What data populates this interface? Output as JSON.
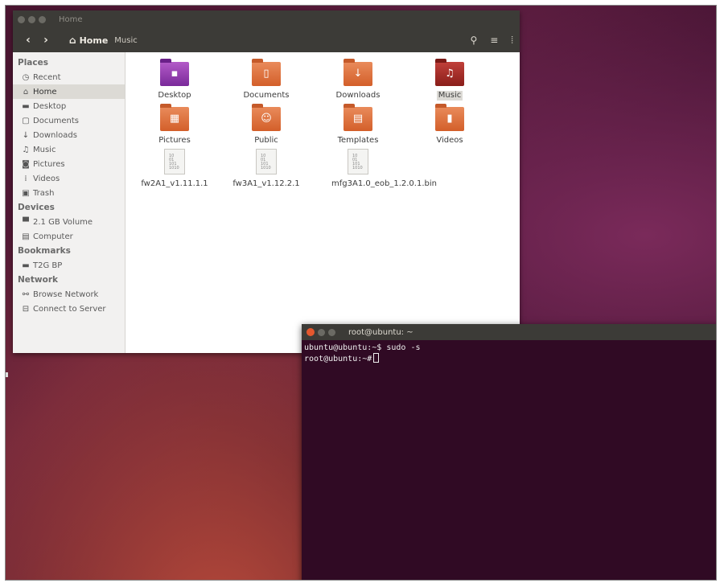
{
  "nautilus": {
    "window_title": "Home",
    "breadcrumb": {
      "home": "Home",
      "next": "Music"
    },
    "sidebar": {
      "places_header": "Places",
      "places": [
        {
          "label": "Recent",
          "icon": "clock-icon"
        },
        {
          "label": "Home",
          "icon": "home-icon"
        },
        {
          "label": "Desktop",
          "icon": "folder-icon"
        },
        {
          "label": "Documents",
          "icon": "document-icon"
        },
        {
          "label": "Downloads",
          "icon": "download-icon"
        },
        {
          "label": "Music",
          "icon": "music-icon"
        },
        {
          "label": "Pictures",
          "icon": "camera-icon"
        },
        {
          "label": "Videos",
          "icon": "film-icon"
        },
        {
          "label": "Trash",
          "icon": "trash-icon"
        }
      ],
      "devices_header": "Devices",
      "devices": [
        {
          "label": "2.1 GB Volume",
          "icon": "drive-icon"
        },
        {
          "label": "Computer",
          "icon": "computer-icon"
        }
      ],
      "bookmarks_header": "Bookmarks",
      "bookmarks": [
        {
          "label": "T2G BP",
          "icon": "folder-icon"
        }
      ],
      "network_header": "Network",
      "network": [
        {
          "label": "Browse Network",
          "icon": "network-icon"
        },
        {
          "label": "Connect to Server",
          "icon": "server-icon"
        }
      ]
    },
    "files": [
      {
        "name": "Desktop",
        "type": "folder"
      },
      {
        "name": "Documents",
        "type": "folder"
      },
      {
        "name": "Downloads",
        "type": "folder"
      },
      {
        "name": "Music",
        "type": "folder"
      },
      {
        "name": "Pictures",
        "type": "folder"
      },
      {
        "name": "Public",
        "type": "folder"
      },
      {
        "name": "Templates",
        "type": "folder"
      },
      {
        "name": "Videos",
        "type": "folder"
      },
      {
        "name": "fw2A1_v1.11.1.1",
        "type": "file"
      },
      {
        "name": "fw3A1_v1.12.2.1",
        "type": "file"
      },
      {
        "name": "mfg3A1.0_eob_1.2.0.1.bin",
        "type": "file"
      }
    ]
  },
  "terminal": {
    "title": "root@ubuntu: ~",
    "lines": [
      "ubuntu@ubuntu:~$ sudo -s",
      "root@ubuntu:~#"
    ]
  }
}
